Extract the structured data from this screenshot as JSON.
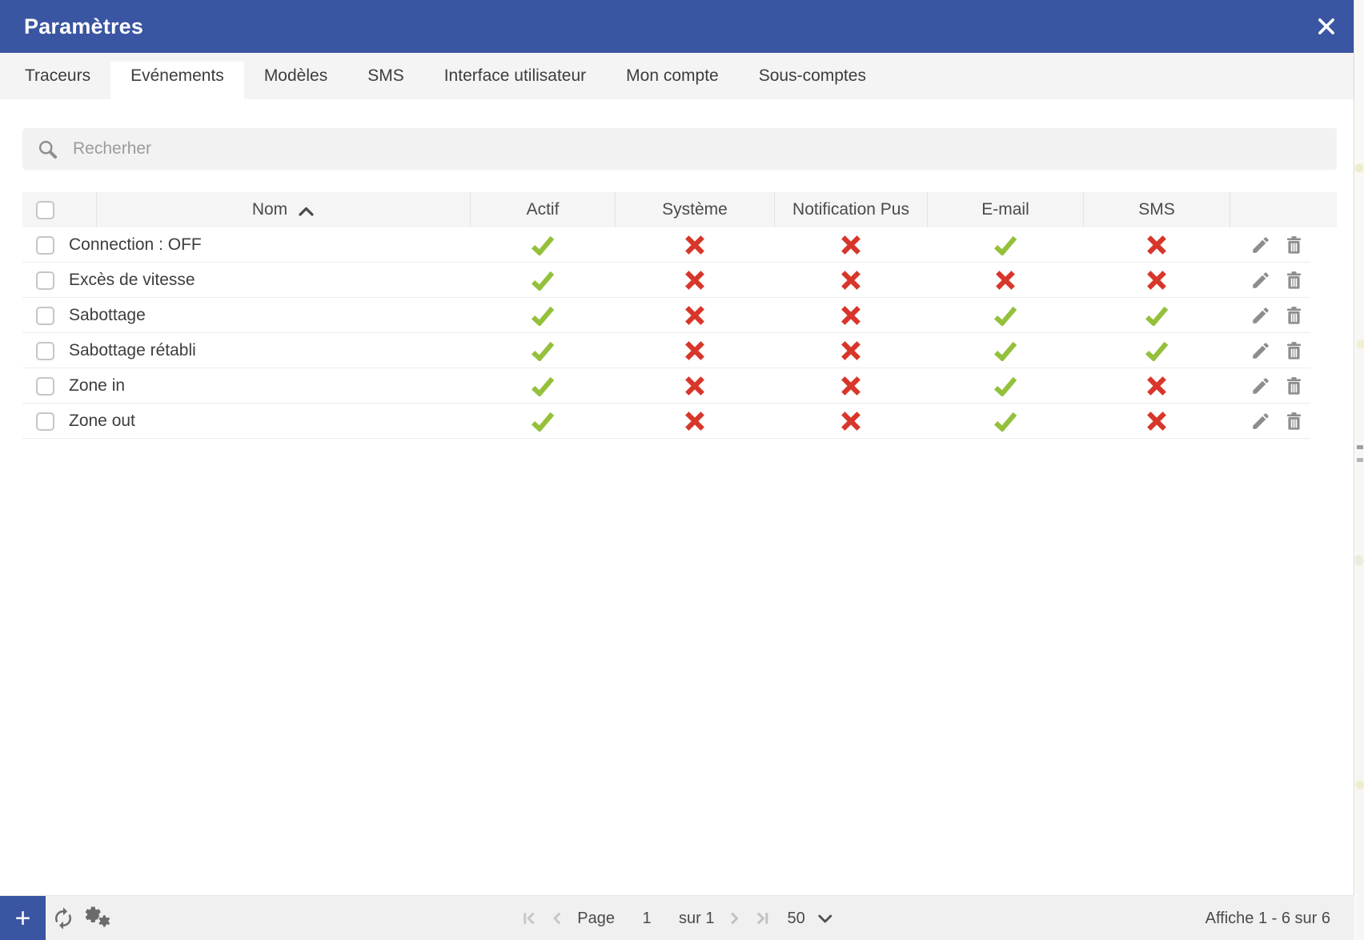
{
  "dialog": {
    "title": "Paramètres"
  },
  "tabs": [
    {
      "id": "traceurs",
      "label": "Traceurs",
      "active": false
    },
    {
      "id": "evenements",
      "label": "Evénements",
      "active": true
    },
    {
      "id": "modeles",
      "label": "Modèles",
      "active": false
    },
    {
      "id": "sms",
      "label": "SMS",
      "active": false
    },
    {
      "id": "interface-utilisateur",
      "label": "Interface utilisateur",
      "active": false
    },
    {
      "id": "mon-compte",
      "label": "Mon compte",
      "active": false
    },
    {
      "id": "sous-comptes",
      "label": "Sous-comptes",
      "active": false
    }
  ],
  "search": {
    "placeholder": "Recherher"
  },
  "table": {
    "columns": {
      "name": "Nom",
      "active": "Actif",
      "system": "Système",
      "push": "Notification Pus",
      "email": "E-mail",
      "sms": "SMS"
    },
    "sort": {
      "column": "Nom",
      "direction": "asc"
    },
    "rows": [
      {
        "name": "Connection : OFF",
        "active": true,
        "system": false,
        "push": false,
        "email": true,
        "sms": false
      },
      {
        "name": "Excès de vitesse",
        "active": true,
        "system": false,
        "push": false,
        "email": false,
        "sms": false
      },
      {
        "name": "Sabottage",
        "active": true,
        "system": false,
        "push": false,
        "email": true,
        "sms": true
      },
      {
        "name": "Sabottage rétabli",
        "active": true,
        "system": false,
        "push": false,
        "email": true,
        "sms": true
      },
      {
        "name": "Zone in",
        "active": true,
        "system": false,
        "push": false,
        "email": true,
        "sms": false
      },
      {
        "name": "Zone out",
        "active": true,
        "system": false,
        "push": false,
        "email": true,
        "sms": false
      }
    ]
  },
  "toolbar": {
    "add_label": "+",
    "pagination": {
      "page_label": "Page",
      "page_value": "1",
      "of_label": "sur 1",
      "page_size": "50"
    },
    "summary": "Affiche 1 - 6 sur 6"
  },
  "icons": {
    "close": "close-x",
    "search": "magnifier",
    "sort_asc": "chevron-up",
    "check": "green-checkmark",
    "cross": "red-x",
    "edit": "pencil",
    "delete": "trash",
    "refresh": "sync-arrows",
    "settings": "double-gear",
    "first_page": "bar-chevron-left",
    "prev_page": "chevron-left",
    "next_page": "chevron-right",
    "last_page": "chevron-right-bar",
    "page_size": "chevron-down"
  },
  "colors": {
    "header_blue": "#3a55a1",
    "check_green": "#94c03c",
    "cross_red": "#d8362a"
  }
}
